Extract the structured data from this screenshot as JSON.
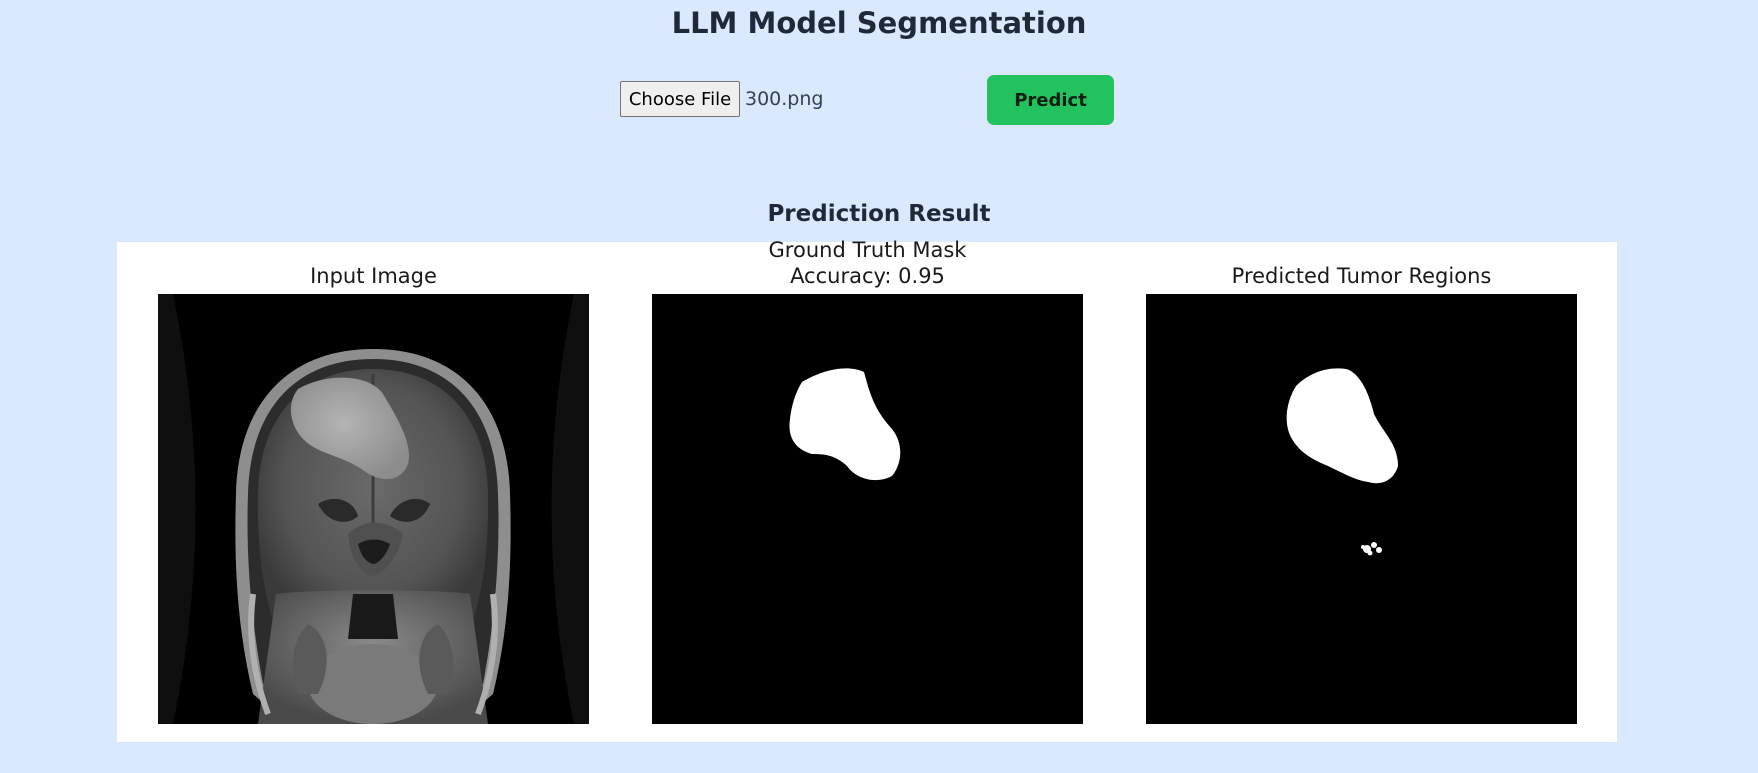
{
  "header": {
    "title": "LLM Model Segmentation"
  },
  "upload": {
    "choose_file_label": "Choose File",
    "file_name": "300.png",
    "predict_label": "Predict"
  },
  "result": {
    "heading": "Prediction Result",
    "panels": [
      {
        "caption": "Input Image"
      },
      {
        "caption": "Ground Truth Mask",
        "subcaption": "Accuracy: 0.95"
      },
      {
        "caption": "Predicted Tumor Regions"
      }
    ]
  },
  "colors": {
    "page_background": "#dbe9fe",
    "predict_button": "#22c35e",
    "panel_background": "#ffffff",
    "image_background": "#000000"
  }
}
